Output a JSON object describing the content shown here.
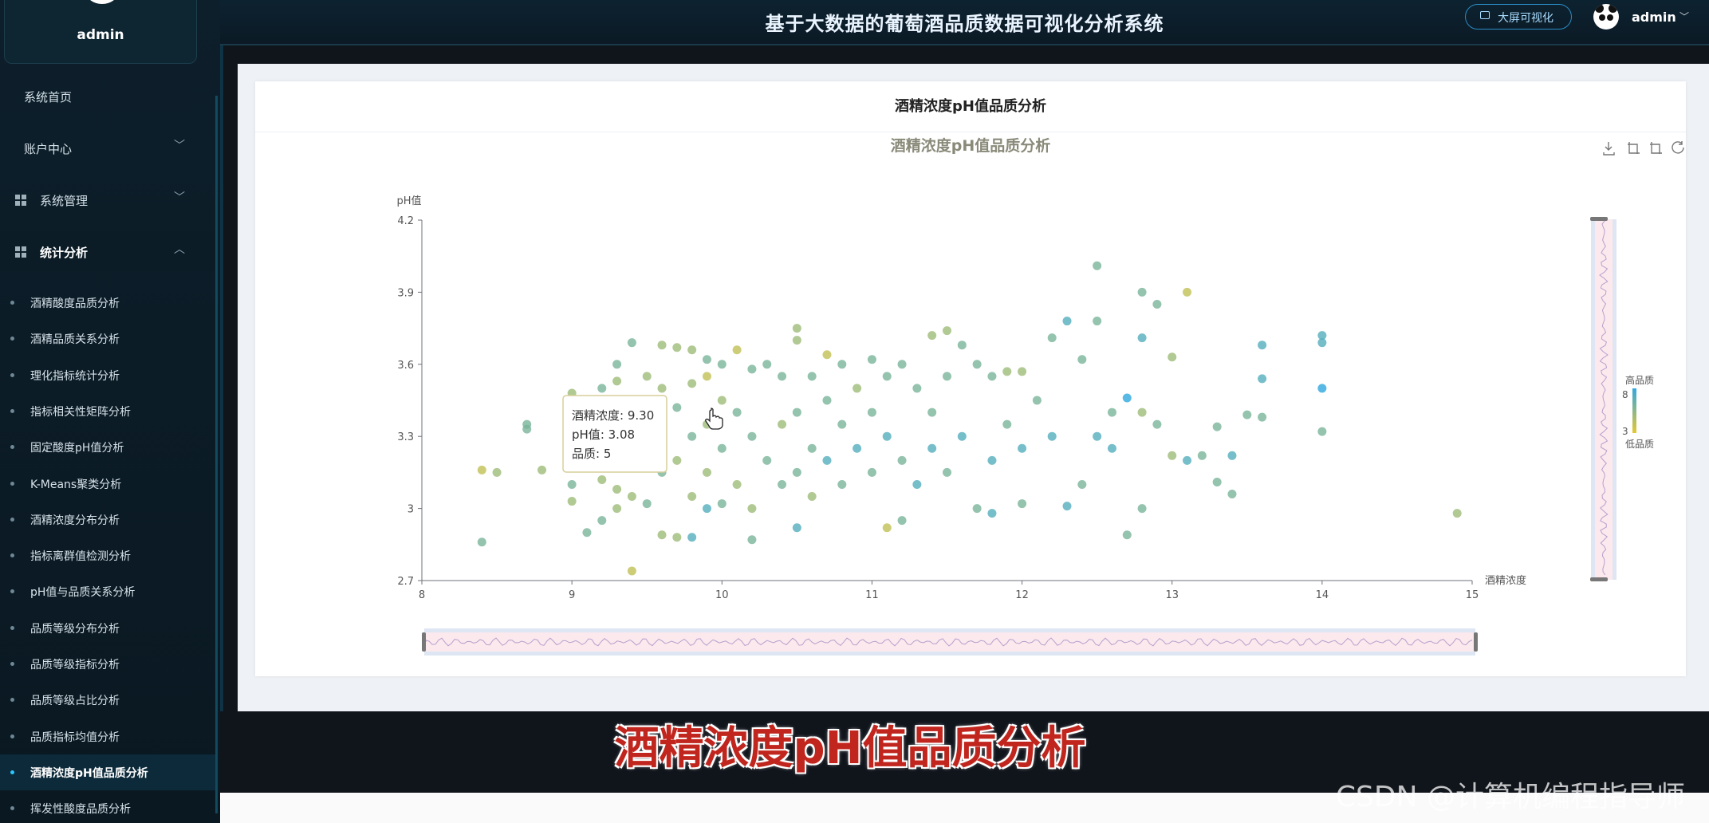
{
  "sidebar": {
    "user_name": "admin",
    "menu": [
      {
        "label": "系统首页",
        "icon": "",
        "chevron": ""
      },
      {
        "label": "账户中心",
        "icon": "",
        "chevron": "﹀"
      },
      {
        "label": "系统管理",
        "icon": "grid-icon",
        "chevron": "﹀"
      },
      {
        "label": "统计分析",
        "icon": "grid-icon",
        "chevron": "︿"
      }
    ],
    "sub_items": [
      "酒精酸度品质分析",
      "酒精品质关系分析",
      "理化指标统计分析",
      "指标相关性矩阵分析",
      "固定酸度pH值分析",
      "K-Means聚类分析",
      "酒精浓度分布分析",
      "指标离群值检测分析",
      "pH值与品质关系分析",
      "品质等级分布分析",
      "品质等级指标分析",
      "品质等级占比分析",
      "品质指标均值分析",
      "酒精浓度pH值品质分析",
      "挥发性酸度品质分析"
    ],
    "active_index": 13
  },
  "header": {
    "title": "基于大数据的葡萄酒品质数据可视化分析系统",
    "bigscreen_label": "大屏可视化",
    "user_name": "admin",
    "chevron": "﹀"
  },
  "card": {
    "title": "酒精浓度pH值品质分析"
  },
  "chart_data": {
    "type": "scatter",
    "title": "酒精浓度pH值品质分析",
    "xlabel": "酒精浓度",
    "ylabel": "pH值",
    "xlim": [
      8,
      15
    ],
    "ylim": [
      2.7,
      4.2
    ],
    "xticks": [
      8,
      9,
      10,
      11,
      12,
      13,
      14,
      15
    ],
    "yticks": [
      2.7,
      3,
      3.3,
      3.6,
      3.9,
      4.2
    ],
    "ytick_labels": [
      "2.7",
      "3",
      "3.3",
      "3.6",
      "3.9",
      "4.2"
    ],
    "grid": false,
    "visual_map": {
      "min": 3,
      "max": 8,
      "high_label": "高品质",
      "low_label": "低品质",
      "colors": [
        "#e6c733",
        "#30a8df"
      ]
    },
    "tooltip": {
      "x_label": "酒精浓度",
      "x": "9.30",
      "y_label": "pH值",
      "y": "3.08",
      "q_label": "品质",
      "q": "5"
    },
    "points": [
      {
        "x": 8.4,
        "y": 3.16,
        "q": 4
      },
      {
        "x": 8.4,
        "y": 2.86,
        "q": 6
      },
      {
        "x": 8.5,
        "y": 3.15,
        "q": 5
      },
      {
        "x": 8.7,
        "y": 3.33,
        "q": 6
      },
      {
        "x": 8.7,
        "y": 3.35,
        "q": 6
      },
      {
        "x": 8.8,
        "y": 3.16,
        "q": 5
      },
      {
        "x": 9.0,
        "y": 3.48,
        "q": 5
      },
      {
        "x": 9.0,
        "y": 3.1,
        "q": 6
      },
      {
        "x": 9.0,
        "y": 3.03,
        "q": 5
      },
      {
        "x": 9.1,
        "y": 2.9,
        "q": 6
      },
      {
        "x": 9.1,
        "y": 3.2,
        "q": 5
      },
      {
        "x": 9.1,
        "y": 3.45,
        "q": 5
      },
      {
        "x": 9.2,
        "y": 3.5,
        "q": 6
      },
      {
        "x": 9.2,
        "y": 3.3,
        "q": 5
      },
      {
        "x": 9.2,
        "y": 2.95,
        "q": 6
      },
      {
        "x": 9.2,
        "y": 3.12,
        "q": 5
      },
      {
        "x": 9.3,
        "y": 3.53,
        "q": 5
      },
      {
        "x": 9.3,
        "y": 3.6,
        "q": 6
      },
      {
        "x": 9.3,
        "y": 3.08,
        "q": 5
      },
      {
        "x": 9.3,
        "y": 3.0,
        "q": 5
      },
      {
        "x": 9.4,
        "y": 3.69,
        "q": 6
      },
      {
        "x": 9.4,
        "y": 2.74,
        "q": 4
      },
      {
        "x": 9.4,
        "y": 3.4,
        "q": 5
      },
      {
        "x": 9.4,
        "y": 3.22,
        "q": 5
      },
      {
        "x": 9.4,
        "y": 3.05,
        "q": 5
      },
      {
        "x": 9.5,
        "y": 3.55,
        "q": 5
      },
      {
        "x": 9.5,
        "y": 3.28,
        "q": 5
      },
      {
        "x": 9.5,
        "y": 3.02,
        "q": 6
      },
      {
        "x": 9.6,
        "y": 3.68,
        "q": 5
      },
      {
        "x": 9.6,
        "y": 3.5,
        "q": 5
      },
      {
        "x": 9.6,
        "y": 2.89,
        "q": 5
      },
      {
        "x": 9.6,
        "y": 3.15,
        "q": 6
      },
      {
        "x": 9.7,
        "y": 3.67,
        "q": 5
      },
      {
        "x": 9.7,
        "y": 3.42,
        "q": 6
      },
      {
        "x": 9.7,
        "y": 2.88,
        "q": 5
      },
      {
        "x": 9.7,
        "y": 3.2,
        "q": 5
      },
      {
        "x": 9.8,
        "y": 3.66,
        "q": 5
      },
      {
        "x": 9.8,
        "y": 3.52,
        "q": 5
      },
      {
        "x": 9.8,
        "y": 3.3,
        "q": 6
      },
      {
        "x": 9.8,
        "y": 2.88,
        "q": 7
      },
      {
        "x": 9.8,
        "y": 3.05,
        "q": 5
      },
      {
        "x": 9.9,
        "y": 3.62,
        "q": 6
      },
      {
        "x": 9.9,
        "y": 3.55,
        "q": 4
      },
      {
        "x": 9.9,
        "y": 3.35,
        "q": 5
      },
      {
        "x": 9.9,
        "y": 3.0,
        "q": 7
      },
      {
        "x": 9.9,
        "y": 3.15,
        "q": 5
      },
      {
        "x": 10.0,
        "y": 3.6,
        "q": 6
      },
      {
        "x": 10.0,
        "y": 3.45,
        "q": 5
      },
      {
        "x": 10.0,
        "y": 3.25,
        "q": 6
      },
      {
        "x": 10.0,
        "y": 3.02,
        "q": 6
      },
      {
        "x": 10.1,
        "y": 3.66,
        "q": 4
      },
      {
        "x": 10.1,
        "y": 3.4,
        "q": 6
      },
      {
        "x": 10.1,
        "y": 3.1,
        "q": 5
      },
      {
        "x": 10.2,
        "y": 3.58,
        "q": 6
      },
      {
        "x": 10.2,
        "y": 3.3,
        "q": 6
      },
      {
        "x": 10.2,
        "y": 2.87,
        "q": 6
      },
      {
        "x": 10.2,
        "y": 3.0,
        "q": 5
      },
      {
        "x": 10.3,
        "y": 3.6,
        "q": 6
      },
      {
        "x": 10.3,
        "y": 3.2,
        "q": 6
      },
      {
        "x": 10.4,
        "y": 3.55,
        "q": 6
      },
      {
        "x": 10.4,
        "y": 3.35,
        "q": 5
      },
      {
        "x": 10.4,
        "y": 3.1,
        "q": 6
      },
      {
        "x": 10.5,
        "y": 3.75,
        "q": 5
      },
      {
        "x": 10.5,
        "y": 3.7,
        "q": 5
      },
      {
        "x": 10.5,
        "y": 3.4,
        "q": 6
      },
      {
        "x": 10.5,
        "y": 2.92,
        "q": 7
      },
      {
        "x": 10.5,
        "y": 3.15,
        "q": 6
      },
      {
        "x": 10.6,
        "y": 3.55,
        "q": 6
      },
      {
        "x": 10.6,
        "y": 3.25,
        "q": 6
      },
      {
        "x": 10.6,
        "y": 3.05,
        "q": 5
      },
      {
        "x": 10.7,
        "y": 3.64,
        "q": 4
      },
      {
        "x": 10.7,
        "y": 3.45,
        "q": 6
      },
      {
        "x": 10.7,
        "y": 3.2,
        "q": 7
      },
      {
        "x": 10.8,
        "y": 3.6,
        "q": 6
      },
      {
        "x": 10.8,
        "y": 3.35,
        "q": 6
      },
      {
        "x": 10.8,
        "y": 3.1,
        "q": 6
      },
      {
        "x": 10.9,
        "y": 3.5,
        "q": 5
      },
      {
        "x": 10.9,
        "y": 3.25,
        "q": 7
      },
      {
        "x": 11.0,
        "y": 3.62,
        "q": 6
      },
      {
        "x": 11.0,
        "y": 3.4,
        "q": 6
      },
      {
        "x": 11.0,
        "y": 3.15,
        "q": 6
      },
      {
        "x": 11.1,
        "y": 3.55,
        "q": 6
      },
      {
        "x": 11.1,
        "y": 2.92,
        "q": 4
      },
      {
        "x": 11.1,
        "y": 3.3,
        "q": 7
      },
      {
        "x": 11.2,
        "y": 3.6,
        "q": 6
      },
      {
        "x": 11.2,
        "y": 2.95,
        "q": 6
      },
      {
        "x": 11.2,
        "y": 3.2,
        "q": 6
      },
      {
        "x": 11.3,
        "y": 3.5,
        "q": 6
      },
      {
        "x": 11.3,
        "y": 3.1,
        "q": 7
      },
      {
        "x": 11.4,
        "y": 3.72,
        "q": 5
      },
      {
        "x": 11.4,
        "y": 3.4,
        "q": 6
      },
      {
        "x": 11.4,
        "y": 3.25,
        "q": 7
      },
      {
        "x": 11.5,
        "y": 3.74,
        "q": 5
      },
      {
        "x": 11.5,
        "y": 3.55,
        "q": 6
      },
      {
        "x": 11.5,
        "y": 3.15,
        "q": 6
      },
      {
        "x": 11.6,
        "y": 3.68,
        "q": 6
      },
      {
        "x": 11.6,
        "y": 3.3,
        "q": 7
      },
      {
        "x": 11.7,
        "y": 3.6,
        "q": 6
      },
      {
        "x": 11.7,
        "y": 3.0,
        "q": 6
      },
      {
        "x": 11.8,
        "y": 3.55,
        "q": 6
      },
      {
        "x": 11.8,
        "y": 3.2,
        "q": 7
      },
      {
        "x": 11.8,
        "y": 2.98,
        "q": 7
      },
      {
        "x": 11.9,
        "y": 3.57,
        "q": 5
      },
      {
        "x": 11.9,
        "y": 3.35,
        "q": 6
      },
      {
        "x": 12.0,
        "y": 3.57,
        "q": 5
      },
      {
        "x": 12.0,
        "y": 3.25,
        "q": 7
      },
      {
        "x": 12.0,
        "y": 3.02,
        "q": 6
      },
      {
        "x": 12.1,
        "y": 3.45,
        "q": 6
      },
      {
        "x": 12.2,
        "y": 3.71,
        "q": 6
      },
      {
        "x": 12.2,
        "y": 3.3,
        "q": 7
      },
      {
        "x": 12.3,
        "y": 3.78,
        "q": 7
      },
      {
        "x": 12.3,
        "y": 3.01,
        "q": 7
      },
      {
        "x": 12.4,
        "y": 3.62,
        "q": 6
      },
      {
        "x": 12.4,
        "y": 3.1,
        "q": 6
      },
      {
        "x": 12.5,
        "y": 4.01,
        "q": 6
      },
      {
        "x": 12.5,
        "y": 3.78,
        "q": 6
      },
      {
        "x": 12.5,
        "y": 3.3,
        "q": 7
      },
      {
        "x": 12.6,
        "y": 3.4,
        "q": 6
      },
      {
        "x": 12.6,
        "y": 3.25,
        "q": 7
      },
      {
        "x": 12.7,
        "y": 3.46,
        "q": 8
      },
      {
        "x": 12.7,
        "y": 2.89,
        "q": 6
      },
      {
        "x": 12.8,
        "y": 3.9,
        "q": 6
      },
      {
        "x": 12.8,
        "y": 3.71,
        "q": 7
      },
      {
        "x": 12.8,
        "y": 3.4,
        "q": 5
      },
      {
        "x": 12.8,
        "y": 3.0,
        "q": 6
      },
      {
        "x": 12.9,
        "y": 3.85,
        "q": 6
      },
      {
        "x": 12.9,
        "y": 3.35,
        "q": 6
      },
      {
        "x": 13.0,
        "y": 3.63,
        "q": 5
      },
      {
        "x": 13.0,
        "y": 3.22,
        "q": 5
      },
      {
        "x": 13.1,
        "y": 3.9,
        "q": 4
      },
      {
        "x": 13.1,
        "y": 3.2,
        "q": 7
      },
      {
        "x": 13.2,
        "y": 3.22,
        "q": 6
      },
      {
        "x": 13.3,
        "y": 3.34,
        "q": 6
      },
      {
        "x": 13.3,
        "y": 3.11,
        "q": 6
      },
      {
        "x": 13.4,
        "y": 3.22,
        "q": 7
      },
      {
        "x": 13.4,
        "y": 3.06,
        "q": 6
      },
      {
        "x": 13.5,
        "y": 3.39,
        "q": 6
      },
      {
        "x": 13.6,
        "y": 3.68,
        "q": 7
      },
      {
        "x": 13.6,
        "y": 3.54,
        "q": 7
      },
      {
        "x": 13.6,
        "y": 3.38,
        "q": 6
      },
      {
        "x": 14.0,
        "y": 3.72,
        "q": 7
      },
      {
        "x": 14.0,
        "y": 3.69,
        "q": 7
      },
      {
        "x": 14.0,
        "y": 3.5,
        "q": 8
      },
      {
        "x": 14.0,
        "y": 3.32,
        "q": 6
      },
      {
        "x": 14.9,
        "y": 2.98,
        "q": 5
      }
    ]
  },
  "caption": "酒精浓度pH值品质分析",
  "watermark": "CSDN @计算机编程指导师"
}
